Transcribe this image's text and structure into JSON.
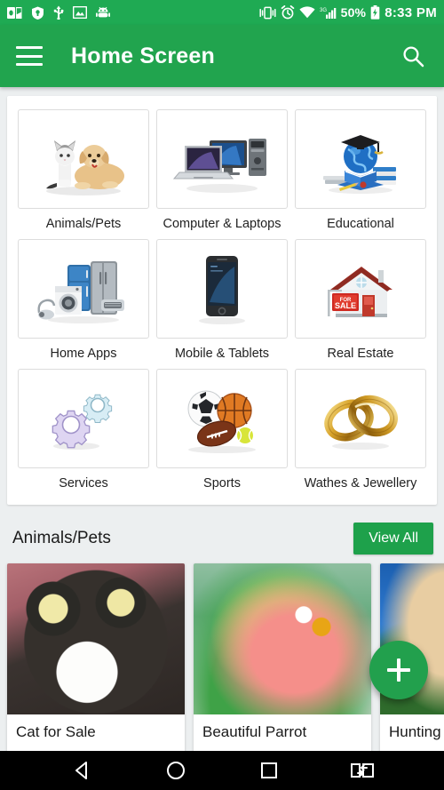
{
  "statusbar": {
    "left_icons": [
      {
        "name": "outlook-mail-icon",
        "label": "Outlook"
      },
      {
        "name": "security-shield-icon",
        "label": "Security"
      },
      {
        "name": "usb-icon",
        "label": "USB"
      },
      {
        "name": "image-icon",
        "label": "Screenshot"
      },
      {
        "name": "android-debug-icon",
        "label": "Android"
      }
    ],
    "right_icons": [
      {
        "name": "vibrate-icon",
        "label": "Vibrate"
      },
      {
        "name": "alarm-clock-icon",
        "label": "Alarm"
      },
      {
        "name": "wifi-icon",
        "label": "Wi-Fi"
      },
      {
        "name": "signal-bars-icon",
        "label": "3G"
      }
    ],
    "network_type": "3G",
    "battery_percent": "50%",
    "time": "8:33 PM"
  },
  "appbar": {
    "menu_icon": "hamburger-menu-icon",
    "title": "Home Screen",
    "search_icon": "search-icon"
  },
  "categories": [
    {
      "label": "Animals/Pets",
      "icon": "cat-and-dog-icon"
    },
    {
      "label": "Computer & Laptops",
      "icon": "laptop-desktop-icon"
    },
    {
      "label": "Educational",
      "icon": "globe-graduation-cap-icon"
    },
    {
      "label": "Home Apps",
      "icon": "home-appliances-icon"
    },
    {
      "label": "Mobile & Tablets",
      "icon": "smartphone-icon"
    },
    {
      "label": "Real Estate",
      "icon": "house-for-sale-icon"
    },
    {
      "label": "Services",
      "icon": "gears-icon"
    },
    {
      "label": "Sports",
      "icon": "sports-balls-icon"
    },
    {
      "label": "Wathes & Jewellery",
      "icon": "gold-rings-icon"
    }
  ],
  "section": {
    "title": "Animals/Pets",
    "view_all_label": "View All"
  },
  "listings": [
    {
      "title": "Cat for Sale",
      "photo": "ph-cat"
    },
    {
      "title": "Beautiful Parrot",
      "photo": "ph-parrot"
    },
    {
      "title": "Hunting",
      "photo": "ph-dog"
    }
  ],
  "fab": {
    "icon": "plus-icon",
    "label": "Add new listing"
  },
  "navbar": [
    {
      "name": "nav-back-button",
      "icon": "back-triangle-icon"
    },
    {
      "name": "nav-home-button",
      "icon": "home-circle-icon"
    },
    {
      "name": "nav-recents-button",
      "icon": "recents-square-icon"
    },
    {
      "name": "nav-screen-switch-button",
      "icon": "screen-switch-icon"
    }
  ],
  "colors": {
    "status_green": "#1faa53",
    "appbar_green": "#21a44e",
    "accent_green": "#1ea14b",
    "fab_green": "#22a04d",
    "page_bg": "#eceff0",
    "navbar_black": "#000000"
  }
}
